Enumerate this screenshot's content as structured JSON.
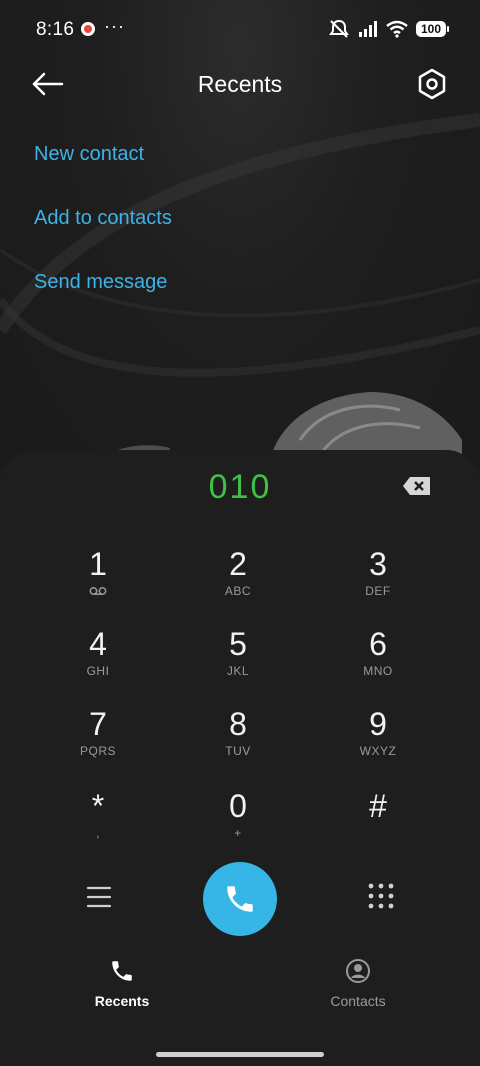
{
  "status_bar": {
    "time": "8:16",
    "dots": "···",
    "battery": "100"
  },
  "header": {
    "title": "Recents"
  },
  "actions": [
    "New contact",
    "Add to contacts",
    "Send message"
  ],
  "dialer": {
    "number": "010",
    "keys": [
      {
        "digit": "1",
        "letters": ""
      },
      {
        "digit": "2",
        "letters": "ABC"
      },
      {
        "digit": "3",
        "letters": "DEF"
      },
      {
        "digit": "4",
        "letters": "GHI"
      },
      {
        "digit": "5",
        "letters": "JKL"
      },
      {
        "digit": "6",
        "letters": "MNO"
      },
      {
        "digit": "7",
        "letters": "PQRS"
      },
      {
        "digit": "8",
        "letters": "TUV"
      },
      {
        "digit": "9",
        "letters": "WXYZ"
      },
      {
        "digit": "*",
        "letters": ","
      },
      {
        "digit": "0",
        "letters": "+"
      },
      {
        "digit": "#",
        "letters": ""
      }
    ]
  },
  "bottom_nav": {
    "recents": "Recents",
    "contacts": "Contacts"
  },
  "colors": {
    "accent_blue": "#35b6e7",
    "link_blue": "#3cb4e6",
    "number_green": "#3ec145",
    "background": "#1b1b1b"
  }
}
